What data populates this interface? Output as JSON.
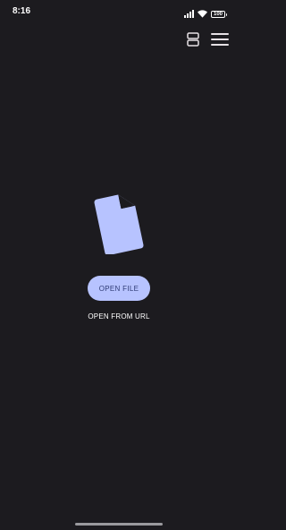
{
  "status_bar": {
    "time": "8:16",
    "battery": "100",
    "icons": [
      "signal-icon",
      "wifi-icon",
      "battery-icon"
    ]
  },
  "toolbar": {
    "icons": [
      "split-view-icon",
      "menu-icon"
    ]
  },
  "main": {
    "illustration_icon": "document-icon",
    "open_file_label": "OPEN FILE",
    "open_url_label": "OPEN FROM URL"
  },
  "colors": {
    "background": "#1c1b1f",
    "accent": "#b7c3ff",
    "accent_text": "#2f3b75",
    "icon": "#e6e1e5"
  }
}
